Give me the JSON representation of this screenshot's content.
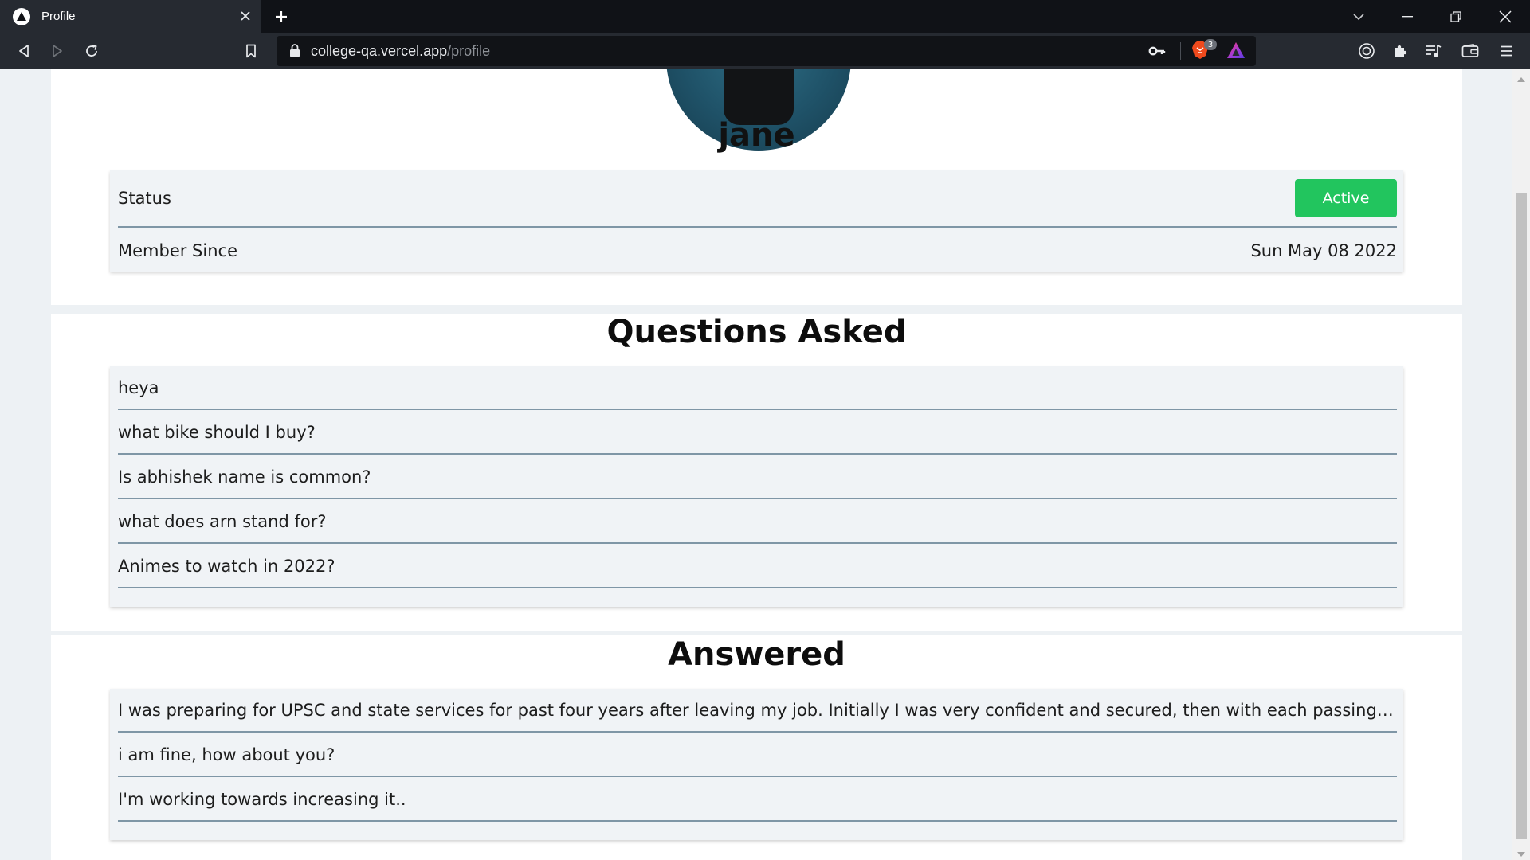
{
  "browser": {
    "tab_title": "Profile",
    "url_host": "college-qa.vercel.app",
    "url_path": "/profile",
    "shields_count": "3"
  },
  "profile": {
    "username": "jane",
    "status_label": "Status",
    "status_value": "Active",
    "member_since_label": "Member Since",
    "member_since_value": "Sun May 08 2022"
  },
  "questions": {
    "title": "Questions Asked",
    "items": [
      "heya",
      "what bike should I buy?",
      "Is abhishek name is common?",
      "what does arn stand for?",
      "Animes to watch in 2022?"
    ]
  },
  "answered": {
    "title": "Answered",
    "items": [
      "I was preparing for UPSC and state services for past four years after leaving my job. Initially I was very confident and secured, then with each passing attempt by confide...",
      "i am fine, how about you?",
      "I'm working towards increasing it.."
    ]
  },
  "colors": {
    "active_badge": "#22c55e",
    "row_divider": "#7f96a6",
    "chrome_dark": "#262a31"
  }
}
